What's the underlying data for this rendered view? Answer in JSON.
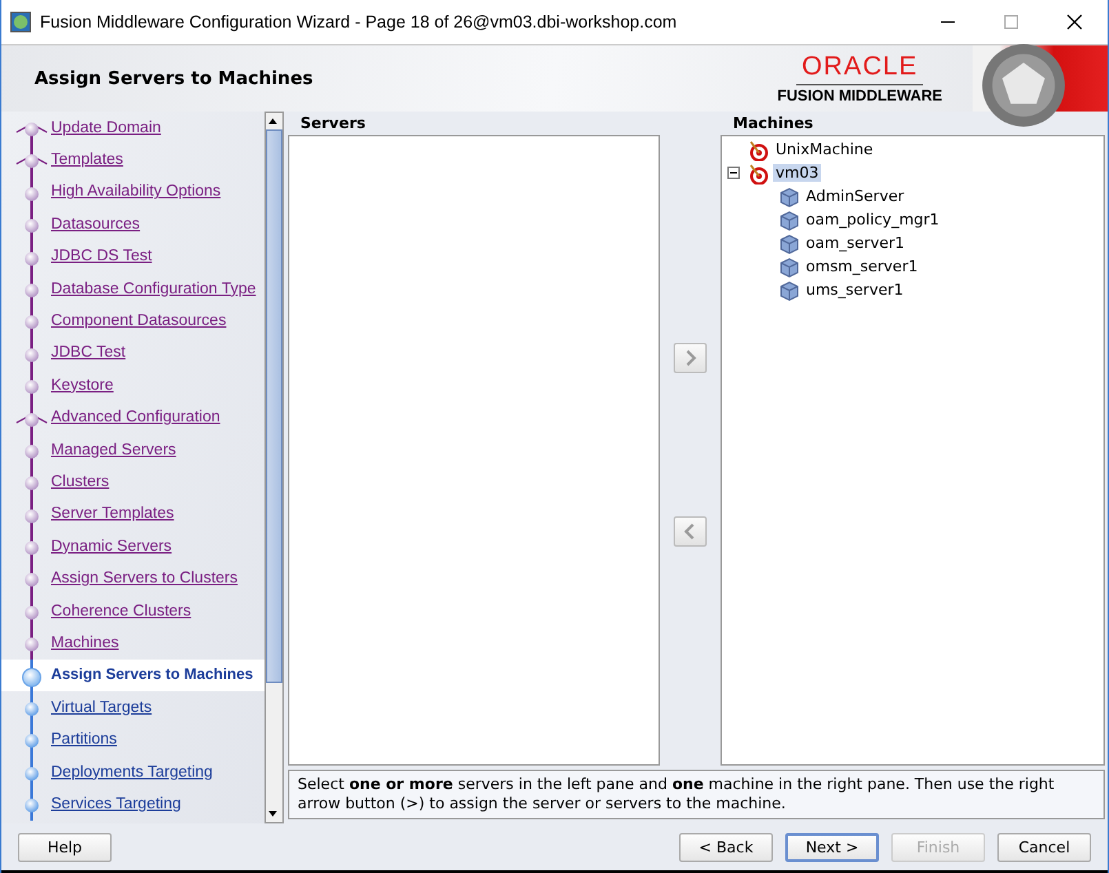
{
  "window": {
    "title": "Fusion Middleware Configuration Wizard - Page 18 of 26@vm03.dbi-workshop.com"
  },
  "header": {
    "title": "Assign Servers to Machines",
    "brand": "ORACLE",
    "product": "FUSION MIDDLEWARE"
  },
  "steps": [
    {
      "label": "Update Domain",
      "completed": true,
      "selected": false,
      "branch": true
    },
    {
      "label": "Templates",
      "completed": true,
      "selected": false,
      "branch": true
    },
    {
      "label": "High Availability Options",
      "completed": true,
      "selected": false,
      "branch": false
    },
    {
      "label": "Datasources",
      "completed": true,
      "selected": false,
      "branch": false
    },
    {
      "label": "JDBC DS Test",
      "completed": true,
      "selected": false,
      "branch": false
    },
    {
      "label": "Database Configuration Type",
      "completed": true,
      "selected": false,
      "branch": false
    },
    {
      "label": "Component Datasources",
      "completed": true,
      "selected": false,
      "branch": false
    },
    {
      "label": "JDBC Test",
      "completed": true,
      "selected": false,
      "branch": false
    },
    {
      "label": "Keystore",
      "completed": true,
      "selected": false,
      "branch": false
    },
    {
      "label": "Advanced Configuration",
      "completed": true,
      "selected": false,
      "branch": true
    },
    {
      "label": "Managed Servers",
      "completed": true,
      "selected": false,
      "branch": false
    },
    {
      "label": "Clusters",
      "completed": true,
      "selected": false,
      "branch": false
    },
    {
      "label": "Server Templates",
      "completed": true,
      "selected": false,
      "branch": false
    },
    {
      "label": "Dynamic Servers",
      "completed": true,
      "selected": false,
      "branch": false
    },
    {
      "label": "Assign Servers to Clusters",
      "completed": true,
      "selected": false,
      "branch": false
    },
    {
      "label": "Coherence Clusters",
      "completed": true,
      "selected": false,
      "branch": false
    },
    {
      "label": "Machines",
      "completed": true,
      "selected": false,
      "branch": false
    },
    {
      "label": "Assign Servers to Machines",
      "completed": false,
      "selected": true,
      "branch": false
    },
    {
      "label": "Virtual Targets",
      "completed": false,
      "selected": false,
      "branch": false
    },
    {
      "label": "Partitions",
      "completed": false,
      "selected": false,
      "branch": false
    },
    {
      "label": "Deployments Targeting",
      "completed": false,
      "selected": false,
      "branch": false
    },
    {
      "label": "Services Targeting",
      "completed": false,
      "selected": false,
      "branch": false
    }
  ],
  "servers_pane": {
    "heading": "Servers"
  },
  "machines_pane": {
    "heading": "Machines",
    "tree": [
      {
        "label": "UnixMachine",
        "kind": "machine",
        "selected": false
      },
      {
        "label": "vm03",
        "kind": "machine",
        "selected": true,
        "expanded": true,
        "children": [
          {
            "label": "AdminServer",
            "kind": "server",
            "selected": false
          },
          {
            "label": "oam_policy_mgr1",
            "kind": "server",
            "selected": false
          },
          {
            "label": "oam_server1",
            "kind": "server",
            "selected": false
          },
          {
            "label": "omsm_server1",
            "kind": "server",
            "selected": false
          },
          {
            "label": "ums_server1",
            "kind": "server",
            "selected": false
          }
        ]
      }
    ]
  },
  "info": "Select **one or more** servers in the left pane and **one** machine in the right pane. Then use the right arrow button (>) to assign the server or servers to the machine.",
  "buttons": [
    {
      "label": "Help",
      "kind": "left",
      "disabled": false,
      "focused": false
    },
    {
      "label": "< Back",
      "kind": "right",
      "disabled": false,
      "focused": false
    },
    {
      "label": "Next >",
      "kind": "right",
      "disabled": false,
      "focused": true
    },
    {
      "label": "Finish",
      "kind": "right",
      "disabled": true,
      "focused": false
    },
    {
      "label": "Cancel",
      "kind": "right",
      "disabled": false,
      "focused": false
    }
  ]
}
